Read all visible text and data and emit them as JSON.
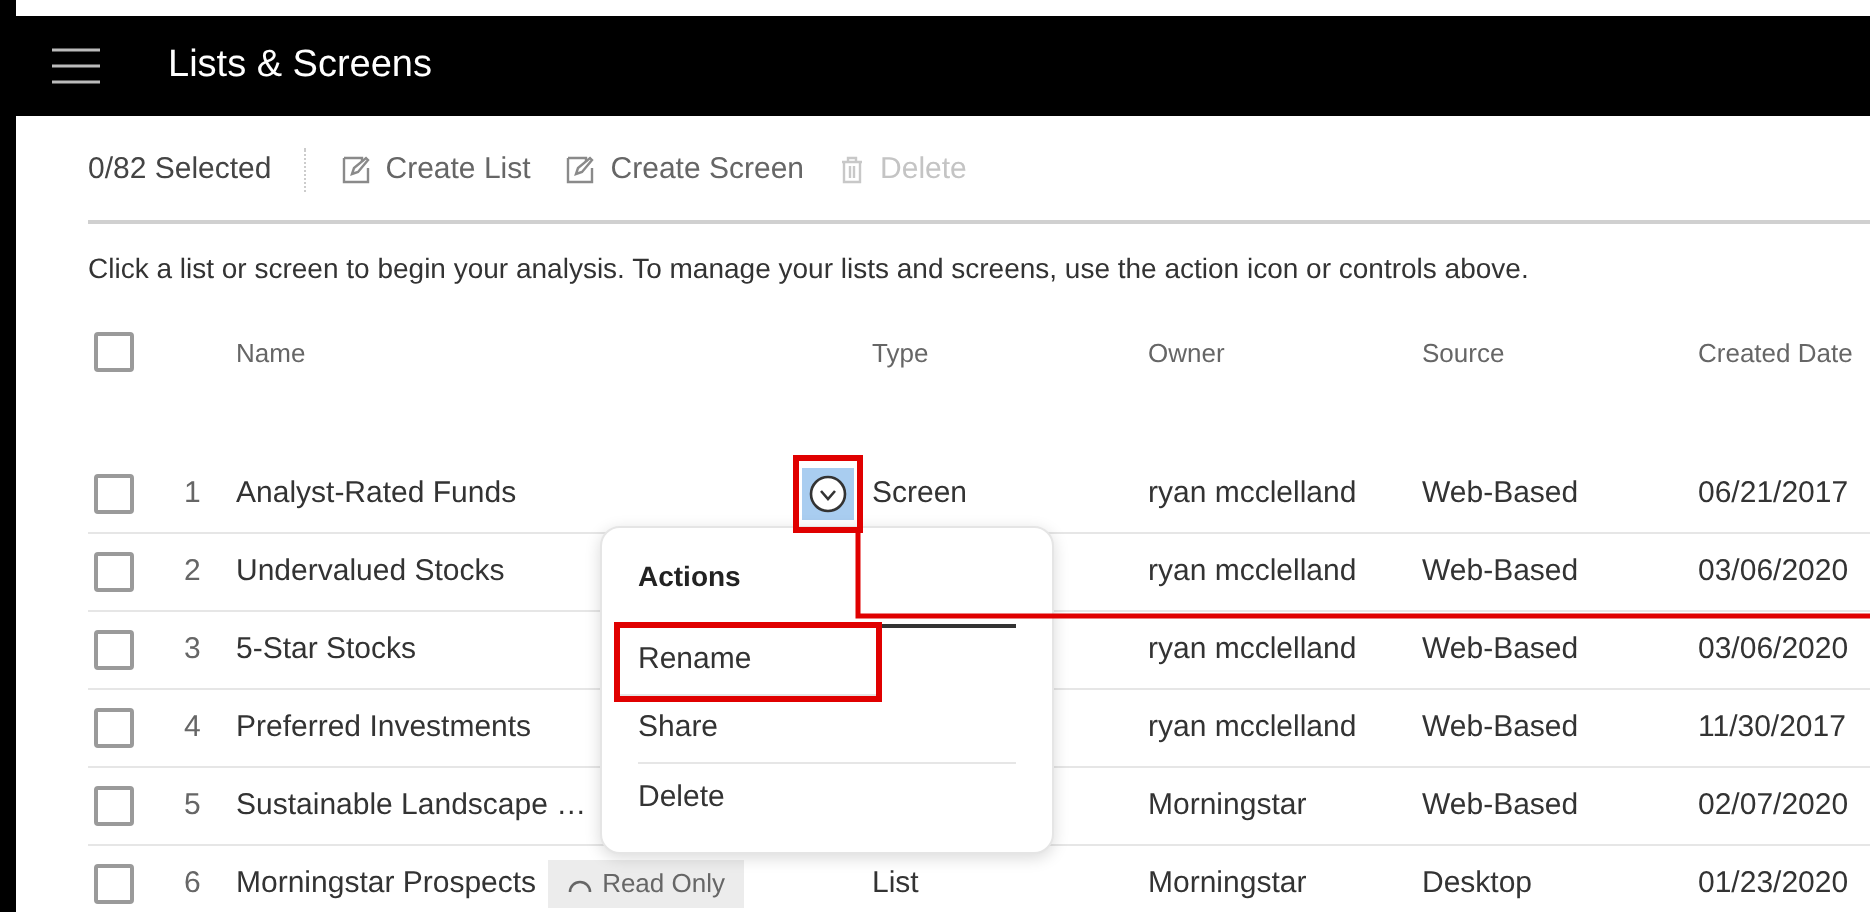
{
  "window": {
    "title": "Lists & Screens"
  },
  "toolbar": {
    "selection_count": "0/82 Selected",
    "buttons": [
      {
        "label": "Create List",
        "kind": "edit",
        "disabled": false
      },
      {
        "label": "Create Screen",
        "kind": "edit",
        "disabled": false
      },
      {
        "label": "Delete",
        "kind": "trash",
        "disabled": true
      }
    ]
  },
  "instructions": "Click a list or screen to begin your analysis. To manage your lists and screens, use the action icon or controls above.",
  "table": {
    "select_all": {
      "checked": false
    },
    "columns": [
      "Name",
      "Type",
      "Owner",
      "Source",
      "Created Date"
    ],
    "rows": [
      {
        "checked": false,
        "number": "1",
        "name": "Analyst-Rated Funds",
        "action_active": true,
        "type": "Screen",
        "owner": "ryan mcclelland",
        "source": "Web-Based",
        "created": "06/21/2017"
      },
      {
        "checked": false,
        "number": "2",
        "name": "Undervalued Stocks",
        "owner": "ryan mcclelland",
        "source": "Web-Based",
        "created": "03/06/2020"
      },
      {
        "checked": false,
        "number": "3",
        "name": "5-Star Stocks",
        "owner": "ryan mcclelland",
        "source": "Web-Based",
        "created": "03/06/2020"
      },
      {
        "checked": false,
        "number": "4",
        "name": "Preferred Investments",
        "owner": "ryan mcclelland",
        "source": "Web-Based",
        "created": "11/30/2017"
      },
      {
        "checked": false,
        "number": "5",
        "name": "Sustainable Landscape …",
        "owner": "Morningstar",
        "source": "Web-Based",
        "created": "02/07/2020"
      },
      {
        "checked": false,
        "number": "6",
        "name": "Morningstar Prospects",
        "badge": "Read Only",
        "type": "List",
        "owner": "Morningstar",
        "source": "Desktop",
        "created": "01/23/2020"
      }
    ]
  },
  "action_menu": {
    "open": true,
    "title": "Actions",
    "items": [
      {
        "label": "Rename",
        "highlighted": true
      },
      {
        "label": "Share",
        "highlighted": false
      },
      {
        "label": "Delete",
        "highlighted": false
      }
    ]
  }
}
